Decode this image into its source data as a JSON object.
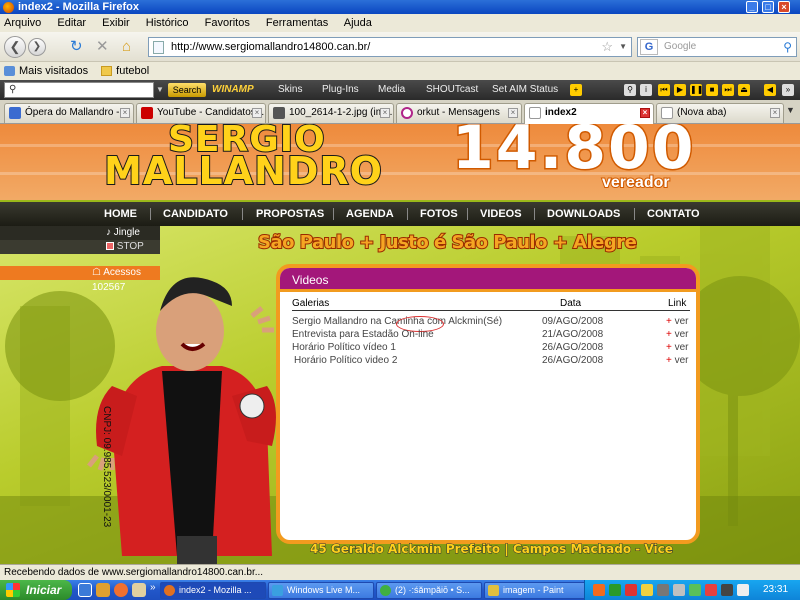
{
  "window": {
    "title": "index2 - Mozilla Firefox"
  },
  "menu": [
    "Arquivo",
    "Editar",
    "Exibir",
    "Histórico",
    "Favoritos",
    "Ferramentas",
    "Ajuda"
  ],
  "navbar": {
    "url": "http://www.sergiomallandro14800.can.br/",
    "search_placeholder": "Google"
  },
  "bookmarks": [
    "Mais visitados",
    "futebol"
  ],
  "toolbar": {
    "search_label": "Search",
    "winamp": "WINAMP",
    "items": [
      "Skins",
      "Plug-Ins",
      "Media",
      "SHOUTcast",
      "Set AIM Status"
    ]
  },
  "tabs": [
    {
      "label": "Ópera do Mallandro - ...",
      "icon_color": "#e03030"
    },
    {
      "label": "YouTube - Candidatos...",
      "icon_color": "#cc0000"
    },
    {
      "label": "100_2614-1-2.jpg (im...",
      "icon_color": "#555555"
    },
    {
      "label": "orkut - Mensagens",
      "icon_color": "#b0258a"
    },
    {
      "label": "index2",
      "icon_color": "#dddddd"
    },
    {
      "label": "(Nova aba)",
      "icon_color": "#dddddd"
    }
  ],
  "page": {
    "name_line1": "SERGIO",
    "name_line2": "MALLANDRO",
    "number": "14.800",
    "role": "vereador",
    "nav": [
      "HOME",
      "CANDIDATO",
      "PROPOSTAS",
      "AGENDA",
      "FOTOS",
      "VIDEOS",
      "DOWNLOADS",
      "CONTATO"
    ],
    "jingle": "Jingle",
    "stop": "STOP",
    "acessos": "Acessos",
    "counter": "102567",
    "slogan": "São Paulo + Justo é São Paulo + Alegre",
    "cnpj": "CNPJ: 09.985.523/0001-23",
    "videos": {
      "title": "Videos",
      "headers": [
        "Galerias",
        "Data",
        "Link"
      ],
      "rows": [
        {
          "title": "Sergio Mallandro na Caminha com Alckmin(Sé)",
          "date": "09/AGO/2008",
          "link": "ver"
        },
        {
          "title": "Entrevista para Estadão On-line",
          "date": "21/AGO/2008",
          "link": "ver"
        },
        {
          "title": "Horário Político vídeo 1",
          "date": "26/AGO/2008",
          "link": "ver"
        },
        {
          "title": "Horário Político video 2",
          "date": "26/AGO/2008",
          "link": "ver"
        }
      ]
    },
    "footer": "45 Geraldo Alckmin Prefeito | Campos Machado - Vice"
  },
  "status": "Recebendo dados de www.sergiomallandro14800.can.br...",
  "taskbar": {
    "start": "Iniciar",
    "tasks": [
      {
        "label": "index2 - Mozilla ...",
        "icon_color": "#e07020"
      },
      {
        "label": "Windows Live M...",
        "icon_color": "#3aa0e0"
      },
      {
        "label": "(2) ·:śămpăiō • S...",
        "icon_color": "#40b040"
      },
      {
        "label": "imagem - Paint",
        "icon_color": "#e0c040"
      }
    ],
    "clock": "23:31"
  }
}
